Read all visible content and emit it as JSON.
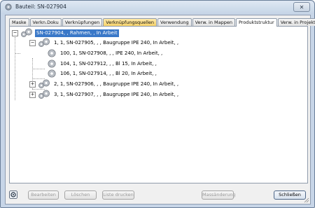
{
  "window": {
    "title": "Bauteil: SN-027904",
    "close_glyph": "✕"
  },
  "tabs": [
    {
      "label": "Maske",
      "state": "normal"
    },
    {
      "label": "Verkn.Doku",
      "state": "normal"
    },
    {
      "label": "Verknüpfungen",
      "state": "normal"
    },
    {
      "label": "Verknüpfungsquellen",
      "state": "highlighted"
    },
    {
      "label": "Verwendung",
      "state": "normal"
    },
    {
      "label": "Verw. in Mappen",
      "state": "normal"
    },
    {
      "label": "Produktstruktur",
      "state": "active"
    },
    {
      "label": "Verw. in Projekten",
      "state": "normal"
    }
  ],
  "tree": {
    "root": {
      "label": "SN-027904, , Rahmen, , In Arbeit",
      "expander": "−",
      "selected": true
    },
    "items": [
      {
        "label": "1, 1, SN-027905, , , Baugruppe IPE 240, In Arbeit, ,",
        "expander": "−"
      },
      {
        "label": "100, 1, SN-027908, , , IPE 240, In Arbeit, ,",
        "expander": ""
      },
      {
        "label": "104, 1, SN-027912, , , Bl 15, In Arbeit, ,",
        "expander": ""
      },
      {
        "label": "106, 1, SN-027914, , , Bl 20, In Arbeit, ,",
        "expander": ""
      },
      {
        "label": "2, 1, SN-027906, , , Baugruppe IPE 240, In Arbeit, ,",
        "expander": "+"
      },
      {
        "label": "3, 1, SN-027907, , , Baugruppe IPE 240, In Arbeit, ,",
        "expander": "+"
      }
    ]
  },
  "buttons": {
    "edit": "Bearbeiten",
    "delete": "Löschen",
    "print_list": "Liste drucken",
    "mass_change": "Massänderung",
    "close": "Schließen"
  },
  "colors": {
    "selection": "#3a78c8",
    "highlight_tab": "#f7d36b",
    "window_frame": "#c7d5e7"
  }
}
